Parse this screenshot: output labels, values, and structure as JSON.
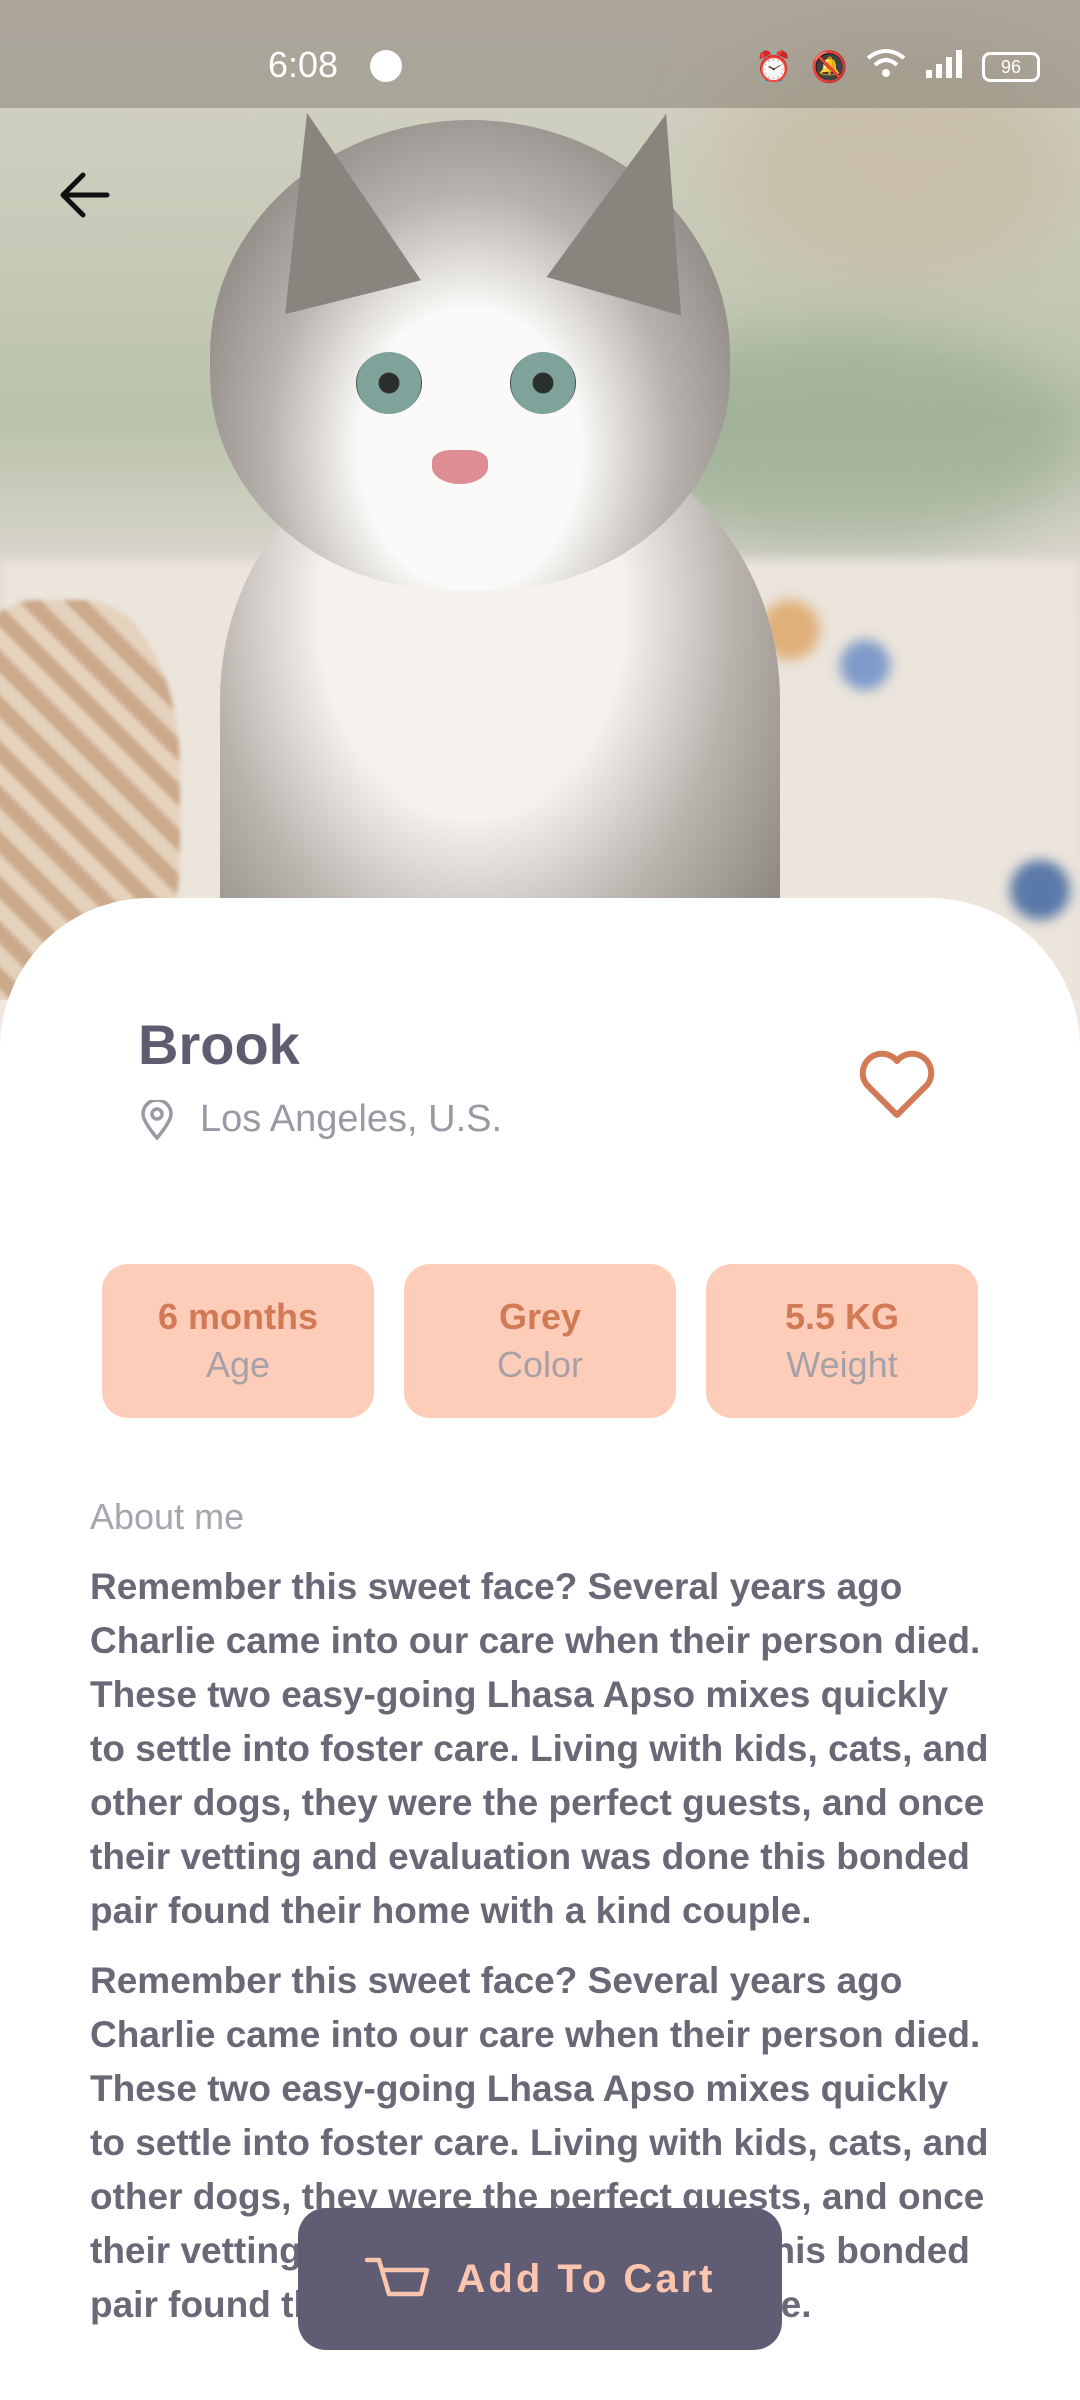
{
  "status_bar": {
    "time": "6:08",
    "battery": "96"
  },
  "header": {
    "back_icon": "arrow-left-icon"
  },
  "hero": {
    "image": "grey-white-kitten-photo"
  },
  "pet": {
    "name": "Brook",
    "location": "Los Angeles, U.S.",
    "location_icon": "location-pin-icon",
    "favorite_icon": "heart-outline-icon"
  },
  "stats": [
    {
      "value": "6 months",
      "label": "Age"
    },
    {
      "value": "Grey",
      "label": "Color"
    },
    {
      "value": "5.5 KG",
      "label": "Weight"
    }
  ],
  "about": {
    "title": "About me",
    "paragraphs": [
      "Remember this sweet face? Several years ago Charlie came into our care when their person died. These two easy-going Lhasa Apso mixes quickly to settle into foster care. Living with kids, cats, and other dogs, they were the perfect guests, and once their vetting and evaluation was done this bonded pair found their home with a kind couple.",
      "Remember this sweet face? Several years ago Charlie came into our care when their person died. These two easy-going Lhasa Apso mixes quickly to settle into foster care. Living with kids, cats, and other dogs, they were the perfect guests, and once their vetting and evaluation was done this bonded pair found their home with a kind couple."
    ]
  },
  "cart_button": {
    "label": "Add To Cart",
    "icon": "cart-icon"
  },
  "colors": {
    "accent": "#d27a55",
    "chip": "#fdcdb9",
    "button": "#605c74",
    "title": "#605c70"
  }
}
